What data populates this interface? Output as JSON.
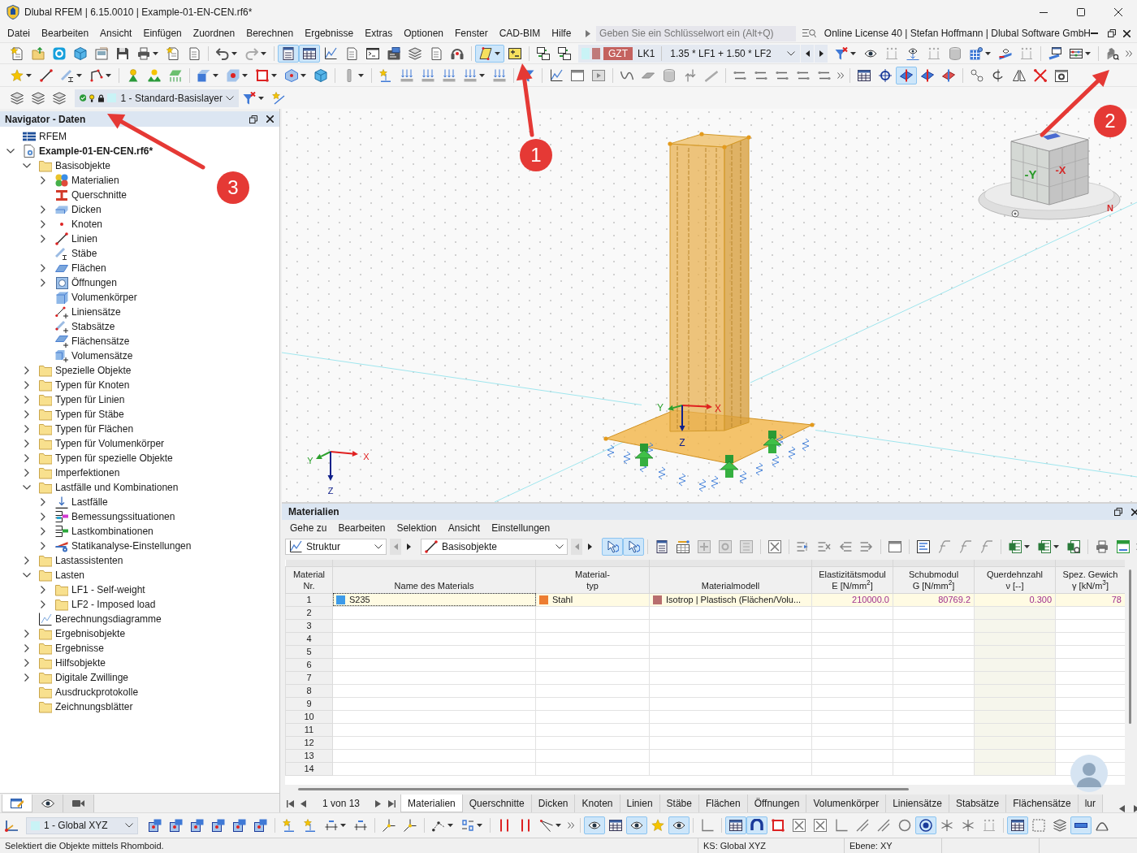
{
  "window": {
    "title": "Dlubal RFEM | 6.15.0010 | Example-01-EN-CEN.rf6*"
  },
  "menu": [
    "Datei",
    "Bearbeiten",
    "Ansicht",
    "Einfügen",
    "Zuordnen",
    "Berechnen",
    "Ergebnisse",
    "Extras",
    "Optionen",
    "Fenster",
    "CAD-BIM",
    "Hilfe"
  ],
  "search": {
    "placeholder": "Geben Sie ein Schlüsselwort ein (Alt+Q)"
  },
  "license": "Online License 40 | Stefan Hoffmann | Dlubal Software GmbH",
  "main_toolbar": [
    {
      "pressed": false
    },
    {
      "pressed": false
    },
    {
      "pressed": false
    },
    {
      "pressed": false
    },
    {
      "pressed": false
    },
    {
      "pressed": false
    },
    {
      "pressed": false
    },
    {
      "pressed": false
    },
    {
      "pressed": false
    },
    {
      "pressed": false
    },
    {
      "pressed": false
    },
    {
      "pressed": true
    },
    {
      "pressed": true
    },
    {
      "pressed": false
    },
    {
      "pressed": false
    },
    {
      "pressed": false
    },
    {
      "pressed": false
    },
    {
      "pressed": false
    },
    {
      "pressed": false
    },
    {
      "pressed": false
    },
    {
      "pressed": true
    },
    {
      "pressed": false
    },
    {
      "pressed": false
    },
    {
      "pressed": false
    },
    {
      "pressed": false
    },
    {
      "pressed": false
    },
    {
      "pressed": false
    },
    {
      "pressed": false
    },
    {
      "pressed": false
    },
    {
      "pressed": false
    },
    {
      "pressed": false
    },
    {
      "pressed": false
    },
    {
      "pressed": false
    },
    {
      "pressed": false
    },
    {
      "pressed": false
    },
    {
      "pressed": false
    }
  ],
  "load_selector": {
    "badge": "GZT",
    "case": "LK1",
    "combination": "1.35 * LF1 + 1.50 * LF2"
  },
  "edit_toolbar": [
    {
      "pressed": false
    },
    {
      "pressed": false
    },
    {
      "pressed": false
    },
    {
      "pressed": false
    },
    {
      "pressed": false
    },
    {
      "pressed": false
    },
    {
      "pressed": false
    },
    {
      "pressed": false
    },
    {
      "pressed": false
    },
    {
      "pressed": false
    },
    {
      "pressed": false
    },
    {
      "pressed": false
    },
    {
      "pressed": false
    },
    {
      "pressed": false
    },
    {
      "pressed": false
    },
    {
      "pressed": false
    },
    {
      "pressed": false
    },
    {
      "pressed": false
    },
    {
      "pressed": false
    },
    {
      "pressed": false
    },
    {
      "pressed": false
    },
    {
      "pressed": false
    },
    {
      "pressed": false
    },
    {
      "pressed": false
    },
    {
      "pressed": false
    },
    {
      "pressed": false
    },
    {
      "pressed": false
    },
    {
      "pressed": false
    },
    {
      "pressed": false
    },
    {
      "pressed": false
    },
    {
      "pressed": false
    },
    {
      "pressed": false
    },
    {
      "pressed": false
    },
    {
      "pressed": false
    },
    {
      "pressed": false
    },
    {
      "pressed": true
    },
    {
      "pressed": false
    },
    {
      "pressed": false
    },
    {
      "pressed": false
    },
    {
      "pressed": false
    },
    {
      "pressed": false
    },
    {
      "pressed": false
    },
    {
      "pressed": false
    }
  ],
  "layer_selector": {
    "value": "1 - Standard-Basislayer"
  },
  "navigator": {
    "title": "Navigator - Daten",
    "tree": [
      {
        "label": "RFEM",
        "kind": "app"
      },
      {
        "label": "Example-01-EN-CEN.rf6*",
        "kind": "model",
        "expanded": true,
        "children": [
          {
            "label": "Basisobjekte",
            "kind": "folder",
            "expanded": true,
            "children": [
              {
                "label": "Materialien",
                "kind": "materials",
                "expanded": false
              },
              {
                "label": "Querschnitte",
                "kind": "section"
              },
              {
                "label": "Dicken",
                "kind": "thickness",
                "expanded": false
              },
              {
                "label": "Knoten",
                "kind": "node",
                "expanded": false
              },
              {
                "label": "Linien",
                "kind": "line",
                "expanded": false
              },
              {
                "label": "Stäbe",
                "kind": "member"
              },
              {
                "label": "Flächen",
                "kind": "surface",
                "expanded": false
              },
              {
                "label": "Öffnungen",
                "kind": "opening",
                "expanded": false
              },
              {
                "label": "Volumenkörper",
                "kind": "solid"
              },
              {
                "label": "Liniensätze",
                "kind": "lineset"
              },
              {
                "label": "Stabsätze",
                "kind": "memberset"
              },
              {
                "label": "Flächensätze",
                "kind": "surfaceset"
              },
              {
                "label": "Volumensätze",
                "kind": "solidset"
              }
            ]
          },
          {
            "label": "Spezielle Objekte",
            "kind": "folder",
            "expanded": false
          },
          {
            "label": "Typen für Knoten",
            "kind": "folder",
            "expanded": false
          },
          {
            "label": "Typen für Linien",
            "kind": "folder",
            "expanded": false
          },
          {
            "label": "Typen für Stäbe",
            "kind": "folder",
            "expanded": false
          },
          {
            "label": "Typen für Flächen",
            "kind": "folder",
            "expanded": false
          },
          {
            "label": "Typen für Volumenkörper",
            "kind": "folder",
            "expanded": false
          },
          {
            "label": "Typen für spezielle Objekte",
            "kind": "folder",
            "expanded": false
          },
          {
            "label": "Imperfektionen",
            "kind": "folder",
            "expanded": false
          },
          {
            "label": "Lastfälle und Kombinationen",
            "kind": "folder",
            "expanded": true,
            "children": [
              {
                "label": "Lastfälle",
                "kind": "loadcase",
                "expanded": false
              },
              {
                "label": "Bemessungssituationen",
                "kind": "design",
                "expanded": false
              },
              {
                "label": "Lastkombinationen",
                "kind": "combination",
                "expanded": false
              },
              {
                "label": "Statikanalyse-Einstellungen",
                "kind": "analysis",
                "expanded": false
              }
            ]
          },
          {
            "label": "Lastassistenten",
            "kind": "folder",
            "expanded": false
          },
          {
            "label": "Lasten",
            "kind": "folder",
            "expanded": true,
            "children": [
              {
                "label": "LF1 - Self-weight",
                "kind": "folder",
                "expanded": false
              },
              {
                "label": "LF2 - Imposed load",
                "kind": "folder",
                "expanded": false
              }
            ]
          },
          {
            "label": "Berechnungsdiagramme",
            "kind": "diagram"
          },
          {
            "label": "Ergebnisobjekte",
            "kind": "folder",
            "expanded": false
          },
          {
            "label": "Ergebnisse",
            "kind": "folder",
            "expanded": false
          },
          {
            "label": "Hilfsobjekte",
            "kind": "folder",
            "expanded": false
          },
          {
            "label": "Digitale Zwillinge",
            "kind": "folder",
            "expanded": false
          },
          {
            "label": "Ausdruckprotokolle",
            "kind": "folder"
          },
          {
            "label": "Zeichnungsblätter",
            "kind": "folder"
          }
        ]
      }
    ],
    "tabs": [
      {
        "selected": true
      },
      {
        "selected": false
      },
      {
        "selected": false
      }
    ]
  },
  "view": {
    "view_cube": {
      "faces": [
        "-Y",
        "-X"
      ],
      "north": "N"
    },
    "local_axes": [
      {
        "label": "Y",
        "color": "#2ca02c"
      },
      {
        "label": "X",
        "color": "#e02020"
      },
      {
        "label": "Z",
        "color": "#10208a"
      }
    ],
    "global_axes": [
      {
        "label": "X",
        "color": "#e02020"
      },
      {
        "label": "Y",
        "color": "#2ca02c"
      },
      {
        "label": "Z",
        "color": "#10208a"
      }
    ]
  },
  "callouts": [
    {
      "number": "1"
    },
    {
      "number": "2"
    },
    {
      "number": "3"
    }
  ],
  "materials_panel": {
    "title": "Materialien",
    "menu": [
      "Gehe zu",
      "Bearbeiten",
      "Selektion",
      "Ansicht",
      "Einstellungen"
    ],
    "filters": [
      {
        "value": "Struktur"
      },
      {
        "value": "Basisobjekte"
      }
    ],
    "toolbar": [
      {
        "pressed": true
      },
      {
        "pressed": true
      },
      {
        "pressed": false
      },
      {
        "pressed": false
      },
      {
        "pressed": false
      },
      {
        "pressed": false
      },
      {
        "pressed": false
      },
      {
        "pressed": false
      },
      {
        "pressed": false
      },
      {
        "pressed": false
      },
      {
        "pressed": false
      },
      {
        "pressed": false
      },
      {
        "pressed": false
      },
      {
        "pressed": false
      },
      {
        "pressed": false
      },
      {
        "pressed": false
      },
      {
        "pressed": false
      },
      {
        "pressed": false
      },
      {
        "pressed": false
      },
      {
        "pressed": false
      },
      {
        "pressed": false
      },
      {
        "pressed": false
      }
    ],
    "table": {
      "columns": [
        {
          "lines": [
            "Material",
            "Nr."
          ]
        },
        {
          "lines": [
            "Name des Materials"
          ]
        },
        {
          "lines": [
            "Material-",
            "typ"
          ]
        },
        {
          "lines": [
            "Materialmodell"
          ]
        },
        {
          "lines": [
            "Elastizitätsmodul",
            "E [N/mm$^{2}$]"
          ]
        },
        {
          "lines": [
            "Schubmodul",
            "G [N/mm$^{2}$]"
          ]
        },
        {
          "lines": [
            "Querdehnzahl",
            "ν [--]"
          ]
        },
        {
          "lines": [
            "Spez. Gewich",
            "γ [kN/m$^{3}$]"
          ]
        }
      ],
      "rows": [
        {
          "selected": true,
          "cells": [
            {
              "text": "1"
            },
            {
              "text": "S235",
              "color": "#3d9be9"
            },
            {
              "text": "Stahl",
              "color": "#ed7d31"
            },
            {
              "text": "Isotrop | Plastisch (Flächen/Volu...",
              "color": "#b86e6e"
            },
            {
              "text": "210000.0"
            },
            {
              "text": "80769.2"
            },
            {
              "text": "0.300"
            },
            {
              "text": "78"
            }
          ]
        },
        {
          "selected": false,
          "cells": [
            {
              "text": "2"
            }
          ]
        },
        {
          "selected": false,
          "cells": [
            {
              "text": "3"
            }
          ]
        },
        {
          "selected": false,
          "cells": [
            {
              "text": "4"
            }
          ]
        },
        {
          "selected": false,
          "cells": [
            {
              "text": "5"
            }
          ]
        },
        {
          "selected": false,
          "cells": [
            {
              "text": "6"
            }
          ]
        },
        {
          "selected": false,
          "cells": [
            {
              "text": "7"
            }
          ]
        },
        {
          "selected": false,
          "cells": [
            {
              "text": "8"
            }
          ]
        },
        {
          "selected": false,
          "cells": [
            {
              "text": "9"
            }
          ]
        },
        {
          "selected": false,
          "cells": [
            {
              "text": "10"
            }
          ]
        },
        {
          "selected": false,
          "cells": [
            {
              "text": "11"
            }
          ]
        },
        {
          "selected": false,
          "cells": [
            {
              "text": "12"
            }
          ]
        },
        {
          "selected": false,
          "cells": [
            {
              "text": "13"
            }
          ]
        },
        {
          "selected": false,
          "cells": [
            {
              "text": "14"
            }
          ]
        }
      ]
    },
    "pager": "1 von 13",
    "tabs": [
      {
        "label": "Materialien",
        "selected": true
      },
      {
        "label": "Querschnitte",
        "selected": false
      },
      {
        "label": "Dicken",
        "selected": false
      },
      {
        "label": "Knoten",
        "selected": false
      },
      {
        "label": "Linien",
        "selected": false
      },
      {
        "label": "Stäbe",
        "selected": false
      },
      {
        "label": "Flächen",
        "selected": false
      },
      {
        "label": "Öffnungen",
        "selected": false
      },
      {
        "label": "Volumenkörper",
        "selected": false
      },
      {
        "label": "Liniensätze",
        "selected": false
      },
      {
        "label": "Stabsätze",
        "selected": false
      },
      {
        "label": "Flächensätze",
        "selected": false
      },
      {
        "label": "lur",
        "selected": false
      }
    ]
  },
  "bottom_toolbar": {
    "coordinate_system": "1 - Global XYZ",
    "buttons": [
      {
        "pressed": false
      },
      {
        "pressed": false
      },
      {
        "pressed": false
      },
      {
        "pressed": false
      },
      {
        "pressed": false
      },
      {
        "pressed": false
      },
      {
        "pressed": false
      },
      {
        "pressed": false
      },
      {
        "pressed": false
      },
      {
        "pressed": false
      },
      {
        "pressed": false
      },
      {
        "pressed": false
      },
      {
        "pressed": false
      },
      {
        "pressed": false
      },
      {
        "pressed": false
      },
      {
        "pressed": false
      },
      {
        "pressed": false
      },
      {
        "pressed": true
      },
      {
        "pressed": false
      },
      {
        "pressed": true
      },
      {
        "pressed": false
      },
      {
        "pressed": true
      },
      {
        "pressed": false
      },
      {
        "pressed": true
      },
      {
        "pressed": true
      },
      {
        "pressed": false
      },
      {
        "pressed": false
      },
      {
        "pressed": false
      },
      {
        "pressed": false
      },
      {
        "pressed": false
      },
      {
        "pressed": false
      },
      {
        "pressed": false
      },
      {
        "pressed": true
      },
      {
        "pressed": false
      },
      {
        "pressed": false
      },
      {
        "pressed": false
      },
      {
        "pressed": true
      },
      {
        "pressed": false
      },
      {
        "pressed": false
      },
      {
        "pressed": true
      },
      {
        "pressed": false
      }
    ]
  },
  "status_bar": [
    "Selektiert die Objekte mittels Rhomboid.",
    "KS: Global XYZ",
    "Ebene: XY"
  ]
}
